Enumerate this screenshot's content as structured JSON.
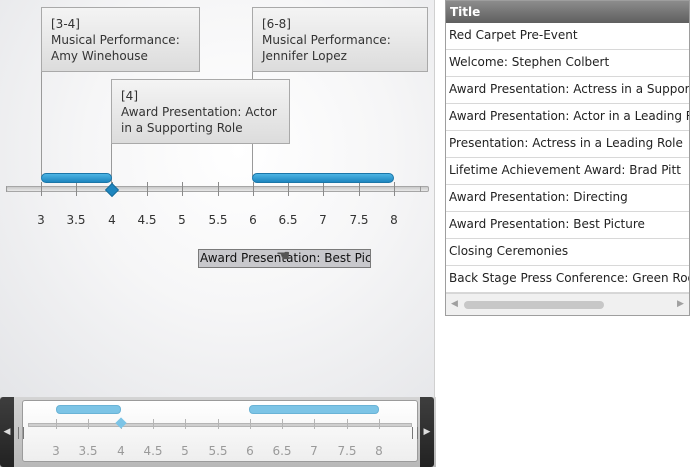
{
  "timeline": {
    "callouts": [
      {
        "range": "[3-4]",
        "title": "Musical Performance: Amy Winehouse"
      },
      {
        "range": "[6-8]",
        "title": "Musical Performance: Jennifer Lopez"
      },
      {
        "range": "[4]",
        "title": "Award Presentation: Actor in a Supporting Role"
      }
    ],
    "tick_labels": [
      "3",
      "3.5",
      "4",
      "4.5",
      "5",
      "5.5",
      "6",
      "6.5",
      "7",
      "7.5",
      "8"
    ],
    "drag_tooltip": "Award Presentation: Best Picture"
  },
  "navigator": {
    "tick_labels": [
      "3",
      "3.5",
      "4",
      "4.5",
      "5",
      "5.5",
      "6",
      "6.5",
      "7",
      "7.5",
      "8"
    ]
  },
  "grid": {
    "header": "Title",
    "rows": [
      "Red Carpet Pre-Event",
      "Welcome: Stephen Colbert",
      "Award Presentation: Actress in a Supporting Role",
      "Award Presentation: Actor in a Leading Role",
      "Presentation: Actress in a Leading Role",
      "Lifetime Achievement Award: Brad Pitt",
      "Award Presentation: Directing",
      "Award Presentation: Best Picture",
      "Closing Ceremonies",
      "Back Stage Press Conference: Green Room"
    ]
  },
  "colors": {
    "accent": "#1e86bf",
    "nav_accent": "#7cc4e6",
    "header": "#6f6f6f"
  }
}
